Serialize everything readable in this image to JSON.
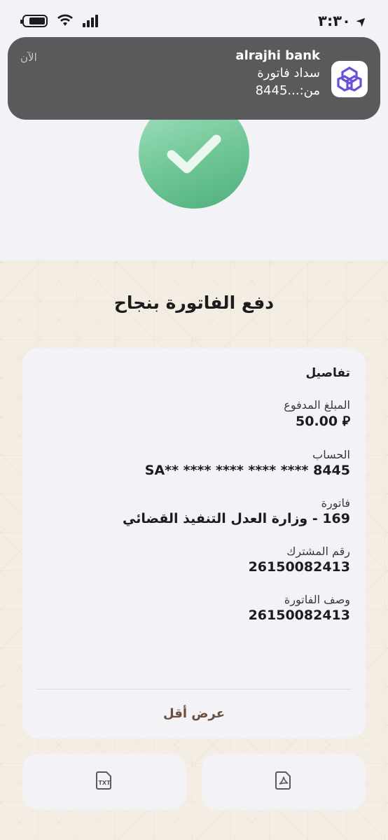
{
  "status_bar": {
    "time": "٣:٣٠"
  },
  "notification": {
    "app_name": "alrajhi bank",
    "line1": "سداد فاتورة",
    "line2": "من:...8445",
    "time": "الآن"
  },
  "page": {
    "title": "دفع الفاتورة بنجاح"
  },
  "details": {
    "heading": "تفاصيل",
    "fields": [
      {
        "label": "المبلغ المدفوع",
        "value": "50.00 ⃁"
      },
      {
        "label": "الحساب",
        "value": "SA** **** **** **** **** 8445"
      },
      {
        "label": "فاتورة",
        "value": "169 - وزارة العدل التنفيذ القضائي"
      },
      {
        "label": "رقم المشترك",
        "value": "26150082413"
      },
      {
        "label": "وصف الفاتورة",
        "value": "26150082413"
      }
    ],
    "toggle_label": "عرض أقل"
  },
  "actions": {
    "left_icon": "txt-file-icon",
    "right_icon": "pdf-file-icon"
  },
  "colors": {
    "success_green": "#5fbc8a",
    "toggle_brown": "#6b4e3d",
    "notification_bg": "#5a5a5c"
  }
}
